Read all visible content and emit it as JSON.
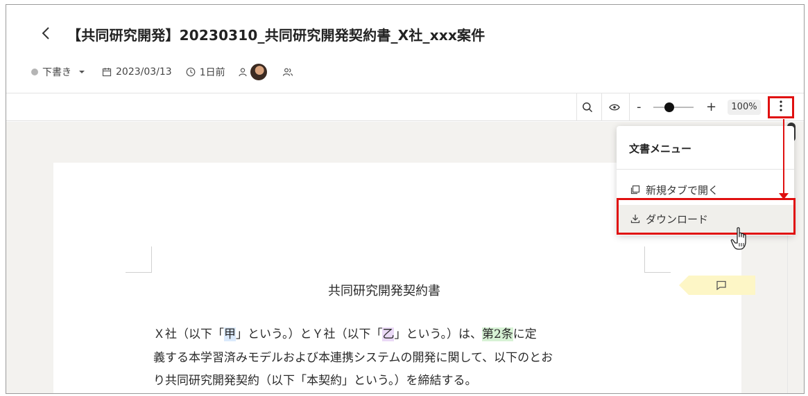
{
  "header": {
    "title": "【共同研究開発】20230310_共同研究開発契約書_X社_xxx案件",
    "status": "下書き",
    "date": "2023/03/13",
    "relative_time": "1日前"
  },
  "toolbar": {
    "zoom_out_label": "-",
    "zoom_in_label": "+",
    "zoom_level": "100%",
    "zoom_slider_fraction": 0.4
  },
  "menu": {
    "title": "文書メニュー",
    "items": [
      {
        "label": "新規タブで開く",
        "icon": "open-in-new-tab-icon"
      },
      {
        "label": "ダウンロード",
        "icon": "download-icon"
      }
    ]
  },
  "document": {
    "heading": "共同研究開発契約書",
    "line1": {
      "p1": "Ｘ社（以下「",
      "kou": "甲",
      "p2": "」という。）とＹ社（以下「",
      "otsu": "乙",
      "p3": "」という。）は、",
      "article": "第2条",
      "p4": "に定"
    },
    "line2": "義する本学習済みモデルおよび本連携システムの開発に関して、以下のとお",
    "line3": "り共同研究開発契約（以下「本契約」という。）を締結する。"
  },
  "colors": {
    "highlight_red": "#e01010",
    "highlight_blue": "#dbeafc",
    "highlight_purple": "#ead9f6",
    "highlight_green": "#d7f2d5",
    "comment_tag": "#fdf6c6"
  }
}
